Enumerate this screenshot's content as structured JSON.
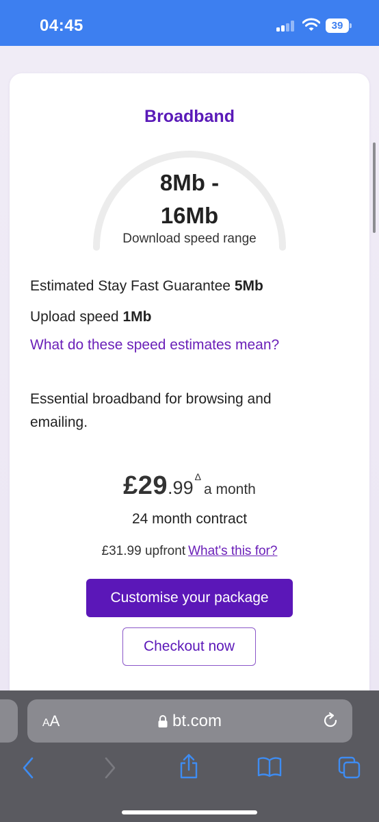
{
  "status_bar": {
    "time": "04:45",
    "battery": "39",
    "icons": [
      "signal-icon",
      "wifi-icon",
      "battery-icon"
    ]
  },
  "product": {
    "title": "Broadband",
    "speed_range_line1": "8Mb -",
    "speed_range_line2": "16Mb",
    "speed_caption": "Download speed range",
    "stay_fast_label": "Estimated Stay Fast Guarantee",
    "stay_fast_value": "5Mb",
    "upload_label": "Upload speed",
    "upload_value": "1Mb",
    "estimates_link": "What do these speed estimates mean?",
    "description": "Essential broadband for browsing and emailing."
  },
  "pricing": {
    "currency_whole": "£29",
    "pence": ".99",
    "footnote_mark": "Δ",
    "period": "a month",
    "contract": "24 month contract",
    "upfront": "£31.99 upfront",
    "upfront_link": "What's this for?"
  },
  "actions": {
    "customise": "Customise your package",
    "checkout": "Checkout now"
  },
  "browser": {
    "aa_label_big": "A",
    "aa_label_small": "A",
    "url": "bt.com",
    "toolbar_icons": [
      "back-icon",
      "forward-icon",
      "share-icon",
      "bookmarks-icon",
      "tabs-icon"
    ]
  },
  "colors": {
    "status_bar": "#3d7ff0",
    "brand_purple": "#5b17b8",
    "link_purple": "#6a1fb8",
    "browser_chrome": "#5a5a60"
  }
}
